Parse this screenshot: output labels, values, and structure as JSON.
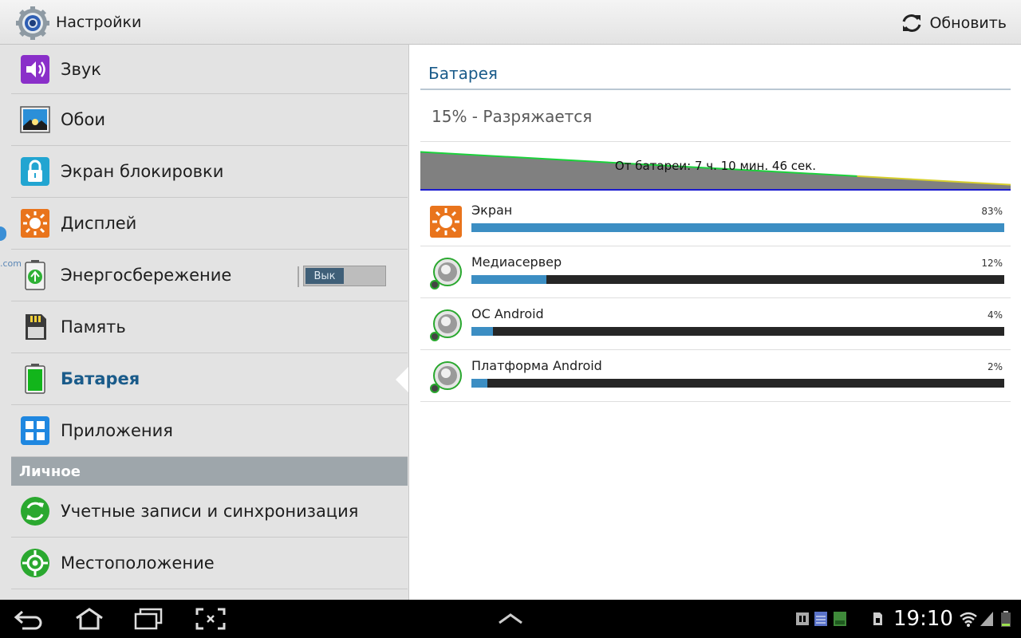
{
  "app": {
    "title": "Настройки",
    "refresh_label": "Обновить"
  },
  "colors": {
    "accent": "#1a5b8a",
    "bar_fill": "#3c8ec3",
    "bar_empty": "#262626",
    "graph_area": "#808080",
    "graph_line": "#1bd13b"
  },
  "menu": {
    "items": [
      {
        "label": "Звук",
        "icon": "sound-icon"
      },
      {
        "label": "Обои",
        "icon": "wallpaper-icon"
      },
      {
        "label": "Экран блокировки",
        "icon": "lock-screen-icon"
      },
      {
        "label": "Дисплей",
        "icon": "display-icon"
      },
      {
        "label": "Энергосбережение",
        "icon": "power-saving-icon",
        "toggle": "Вык"
      },
      {
        "label": "Память",
        "icon": "storage-icon"
      },
      {
        "label": "Батарея",
        "icon": "battery-icon",
        "selected": true
      },
      {
        "label": "Приложения",
        "icon": "applications-icon"
      }
    ],
    "section_personal": "Личное",
    "personal_items": [
      {
        "label": "Учетные записи и синхронизация",
        "icon": "accounts-sync-icon"
      },
      {
        "label": "Местоположение",
        "icon": "location-icon"
      }
    ],
    "side_text": ".com"
  },
  "battery": {
    "title": "Батарея",
    "status": "15% - Разряжается",
    "graph": {
      "label": "От батареи: 7 ч. 10 мин. 46 сек.",
      "level_start": 0.86,
      "level_end": 0.1,
      "level_split": 0.26
    },
    "usage": [
      {
        "name": "Экран",
        "percent_label": "83%",
        "value": 100,
        "icon": "display-icon"
      },
      {
        "name": "Медиасервер",
        "percent_label": "12%",
        "value": 14,
        "icon": "android-system-icon"
      },
      {
        "name": "ОС Android",
        "percent_label": "4%",
        "value": 4,
        "icon": "android-system-icon"
      },
      {
        "name": "Платформа Android",
        "percent_label": "2%",
        "value": 3,
        "icon": "android-system-icon"
      }
    ]
  },
  "system_bar": {
    "time": "19:10"
  }
}
